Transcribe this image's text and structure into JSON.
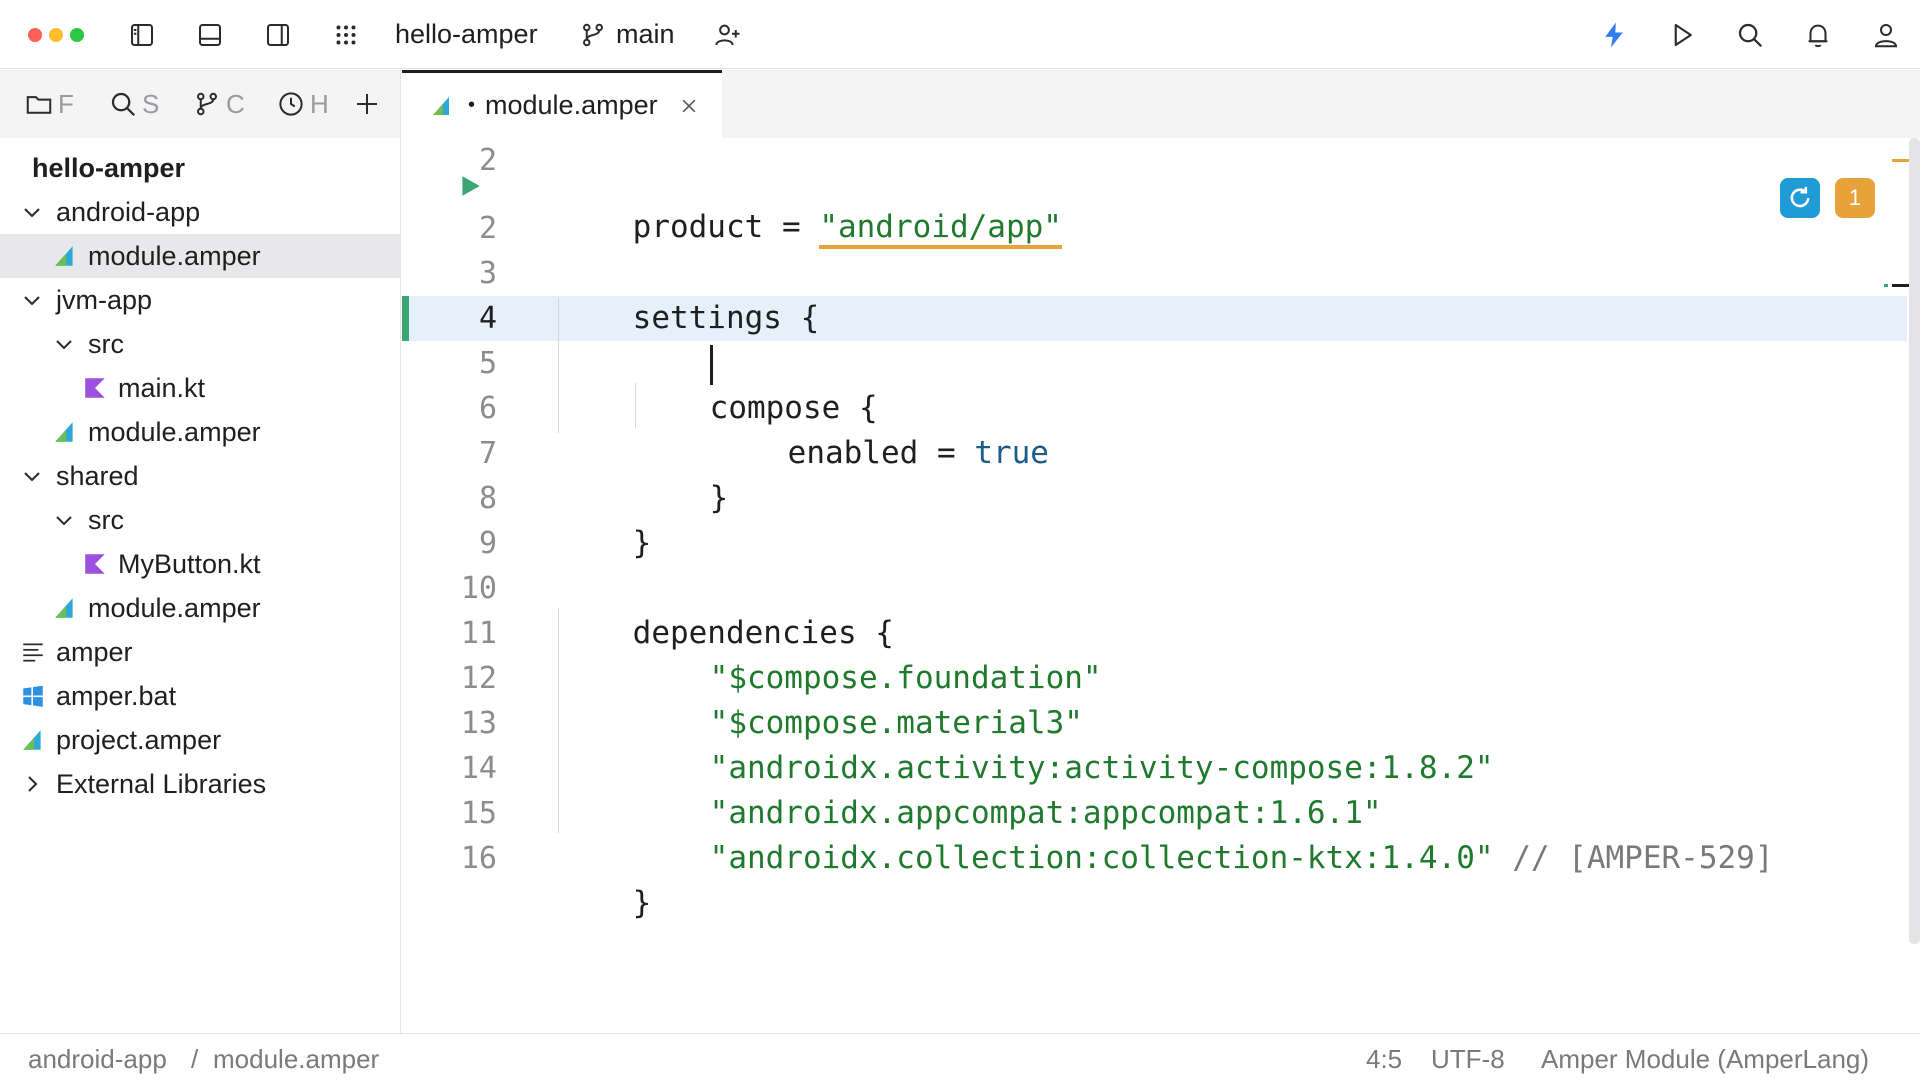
{
  "titlebar": {
    "project_name": "hello-amper",
    "branch": "main",
    "traffic_colors": {
      "close": "#ff5f57",
      "minimize": "#febc2e",
      "zoom": "#28c840"
    },
    "accent_color": "#2f7ff0"
  },
  "left_panel": {
    "tabs": [
      {
        "label": "F",
        "icon": "folder-icon"
      },
      {
        "label": "S",
        "icon": "search-icon"
      },
      {
        "label": "C",
        "icon": "git-commit-icon"
      },
      {
        "label": "H",
        "icon": "clock-icon"
      }
    ],
    "tree": [
      {
        "label": "hello-amper",
        "icon": "none",
        "depth": 0
      },
      {
        "label": "android-app",
        "icon": "chevron-down-icon",
        "depth": 0
      },
      {
        "label": "module.amper",
        "icon": "amper-file-icon",
        "depth": 1,
        "selected": true
      },
      {
        "label": "jvm-app",
        "icon": "chevron-down-icon",
        "depth": 0
      },
      {
        "label": "src",
        "icon": "chevron-down-icon",
        "depth": 1
      },
      {
        "label": "main.kt",
        "icon": "kotlin-file-icon",
        "depth": 2
      },
      {
        "label": "module.amper",
        "icon": "amper-file-icon",
        "depth": 1
      },
      {
        "label": "shared",
        "icon": "chevron-down-icon",
        "depth": 0
      },
      {
        "label": "src",
        "icon": "chevron-down-icon",
        "depth": 1
      },
      {
        "label": "MyButton.kt",
        "icon": "kotlin-file-icon",
        "depth": 2
      },
      {
        "label": "module.amper",
        "icon": "amper-file-icon",
        "depth": 1
      },
      {
        "label": "amper",
        "icon": "text-file-icon",
        "depth": 0
      },
      {
        "label": "amper.bat",
        "icon": "windows-file-icon",
        "depth": 0
      },
      {
        "label": "project.amper",
        "icon": "amper-file-icon",
        "depth": 0
      },
      {
        "label": "External Libraries",
        "icon": "chevron-right-icon",
        "depth": 0
      }
    ]
  },
  "editor": {
    "tab": {
      "label": "module.amper",
      "modified": "•"
    },
    "problem_count": "1",
    "lines": [
      {
        "num": "",
        "text": "product = \"android/app\""
      },
      {
        "num": "2",
        "text": ""
      },
      {
        "num": "3",
        "text": "settings {"
      },
      {
        "num": "4",
        "text": ""
      },
      {
        "num": "5",
        "text": "compose {"
      },
      {
        "num": "6",
        "text": "enabled = true"
      },
      {
        "num": "7",
        "text": "}"
      },
      {
        "num": "8",
        "text": "}"
      },
      {
        "num": "9",
        "text": ""
      },
      {
        "num": "10",
        "text": "dependencies {"
      },
      {
        "num": "11",
        "text": "\"$compose.foundation\""
      },
      {
        "num": "12",
        "text": "\"$compose.material3\""
      },
      {
        "num": "13",
        "text": "\"androidx.activity:activity-compose:1.8.2\""
      },
      {
        "num": "14",
        "text": "\"androidx.appcompat:appcompat:1.6.1\""
      },
      {
        "num": "15",
        "text": "\"androidx.collection:collection-ktx:1.4.0\"",
        "comment": "// [AMPER-529]"
      },
      {
        "num": "16",
        "text": "}"
      }
    ],
    "tokens": {
      "l1_key": "product",
      "l1_eq": " = ",
      "l1_val": "\"android/app\"",
      "l3": "settings {",
      "l5": "compose {",
      "l6_key": "enabled",
      "l6_eq": " = ",
      "l6_val": "true",
      "l7": "}",
      "l8": "}",
      "l10": "dependencies {",
      "l11": "\"$compose.foundation\"",
      "l12": "\"$compose.material3\"",
      "l13": "\"androidx.activity:activity-compose:1.8.2\"",
      "l14": "\"androidx.appcompat:appcompat:1.6.1\"",
      "l15": "\"androidx.collection:collection-ktx:1.4.0\"",
      "l15_comment": " // [AMPER-529]",
      "l16": "}"
    }
  },
  "statusbar": {
    "breadcrumb_1": "android-app",
    "breadcrumb_sep": "/",
    "breadcrumb_2": "module.amper",
    "position": "4:5",
    "encoding": "UTF-8",
    "file_type": "Amper Module (AmperLang)"
  }
}
